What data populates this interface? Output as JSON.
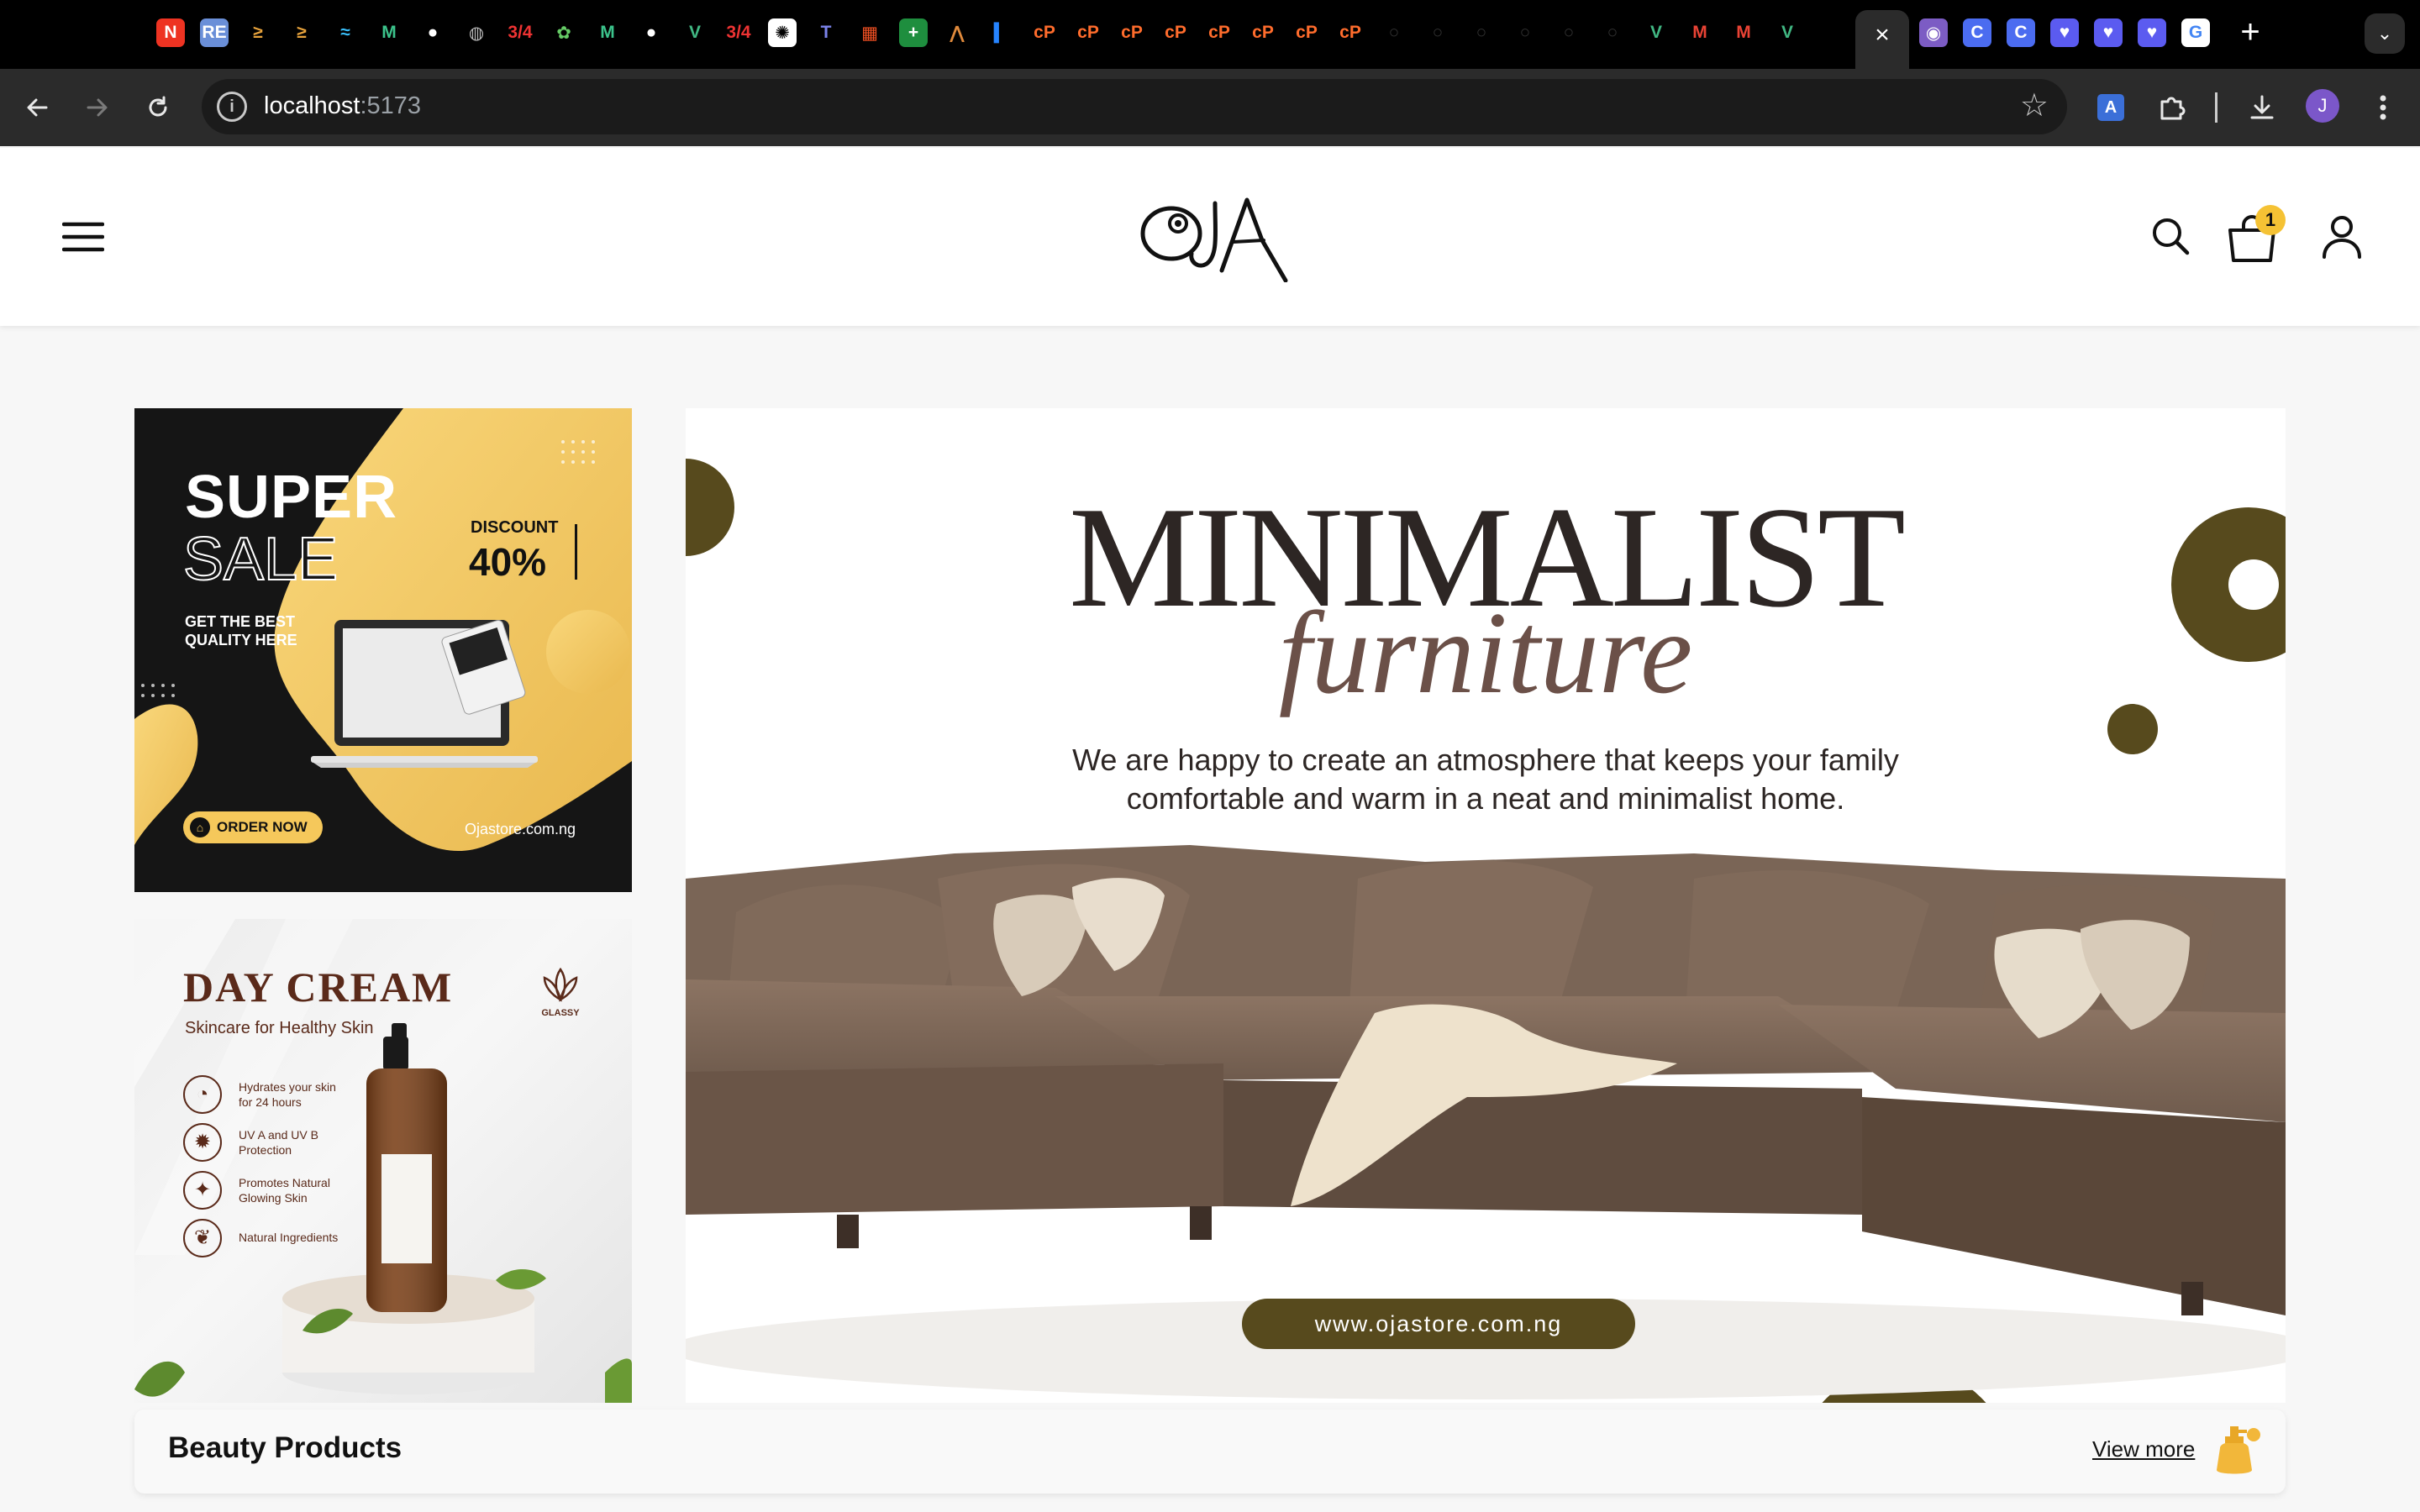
{
  "browser": {
    "url_host": "localhost",
    "url_port": ":5173",
    "profile_initial": "J",
    "tab_favicons": [
      {
        "name": "notion-icon",
        "glyph": "N",
        "bg": "#e32",
        "fg": "#fff"
      },
      {
        "name": "repo-icon",
        "glyph": "RE",
        "bg": "#6a8fd8",
        "fg": "#fff"
      },
      {
        "name": "svelte-icon",
        "glyph": "≥",
        "bg": "#000",
        "fg": "#e8a33c"
      },
      {
        "name": "svelte-icon",
        "glyph": "≥",
        "bg": "#000",
        "fg": "#e8a33c"
      },
      {
        "name": "tailwind-icon",
        "glyph": "≈",
        "bg": "#000",
        "fg": "#38bdf8"
      },
      {
        "name": "mailchimp-icon",
        "glyph": "M",
        "bg": "#000",
        "fg": "#3cc48c"
      },
      {
        "name": "github-icon",
        "glyph": "●",
        "bg": "#000",
        "fg": "#fff"
      },
      {
        "name": "globe-icon",
        "glyph": "◍",
        "bg": "#000",
        "fg": "#bbb"
      },
      {
        "name": "app-icon",
        "glyph": "3/4",
        "bg": "#000",
        "fg": "#e33"
      },
      {
        "name": "bug-icon",
        "glyph": "✿",
        "bg": "#000",
        "fg": "#6c6"
      },
      {
        "name": "mailchimp-icon",
        "glyph": "M",
        "bg": "#000",
        "fg": "#3cc48c"
      },
      {
        "name": "github-icon",
        "glyph": "●",
        "bg": "#000",
        "fg": "#fff"
      },
      {
        "name": "vue-icon",
        "glyph": "V",
        "bg": "#000",
        "fg": "#41b883"
      },
      {
        "name": "app-icon",
        "glyph": "3/4",
        "bg": "#000",
        "fg": "#e33"
      },
      {
        "name": "openai-icon",
        "glyph": "✺",
        "bg": "#fff",
        "fg": "#000"
      },
      {
        "name": "teams-icon",
        "glyph": "T",
        "bg": "#000",
        "fg": "#7b83eb"
      },
      {
        "name": "microsoft-icon",
        "glyph": "▦",
        "bg": "#000",
        "fg": "#f25022"
      },
      {
        "name": "plus-app-icon",
        "glyph": "+",
        "bg": "#1e8e3e",
        "fg": "#fff"
      },
      {
        "name": "triangle-icon",
        "glyph": "⋀",
        "bg": "#000",
        "fg": "#e08a3c"
      },
      {
        "name": "jira-icon",
        "glyph": "▍",
        "bg": "#000",
        "fg": "#2684ff"
      },
      {
        "name": "cpanel-icon",
        "glyph": "cP",
        "bg": "#000",
        "fg": "#ff6c2c"
      },
      {
        "name": "cpanel-icon",
        "glyph": "cP",
        "bg": "#000",
        "fg": "#ff6c2c"
      },
      {
        "name": "cpanel-icon",
        "glyph": "cP",
        "bg": "#000",
        "fg": "#ff6c2c"
      },
      {
        "name": "cpanel-icon",
        "glyph": "cP",
        "bg": "#000",
        "fg": "#ff6c2c"
      },
      {
        "name": "cpanel-icon",
        "glyph": "cP",
        "bg": "#000",
        "fg": "#ff6c2c"
      },
      {
        "name": "cpanel-icon",
        "glyph": "cP",
        "bg": "#000",
        "fg": "#ff6c2c"
      },
      {
        "name": "cpanel-icon",
        "glyph": "cP",
        "bg": "#000",
        "fg": "#ff6c2c"
      },
      {
        "name": "cpanel-icon",
        "glyph": "cP",
        "bg": "#000",
        "fg": "#ff6c2c"
      },
      {
        "name": "loading-icon",
        "glyph": "○",
        "bg": "#000",
        "fg": "#333"
      },
      {
        "name": "loading-icon",
        "glyph": "○",
        "bg": "#000",
        "fg": "#333"
      },
      {
        "name": "loading-icon",
        "glyph": "○",
        "bg": "#000",
        "fg": "#333"
      },
      {
        "name": "loading-icon",
        "glyph": "○",
        "bg": "#000",
        "fg": "#333"
      },
      {
        "name": "loading-icon",
        "glyph": "○",
        "bg": "#000",
        "fg": "#333"
      },
      {
        "name": "loading-icon",
        "glyph": "○",
        "bg": "#000",
        "fg": "#333"
      },
      {
        "name": "vue-icon",
        "glyph": "V",
        "bg": "#000",
        "fg": "#41b883"
      },
      {
        "name": "gmail-icon",
        "glyph": "M",
        "bg": "#000",
        "fg": "#ea4335"
      },
      {
        "name": "gmail-icon",
        "glyph": "M",
        "bg": "#000",
        "fg": "#ea4335"
      },
      {
        "name": "vue-icon",
        "glyph": "V",
        "bg": "#000",
        "fg": "#41b883"
      }
    ],
    "tab_favicons_right": [
      {
        "name": "obsidian-icon",
        "glyph": "◉",
        "bg": "#7c5cc4",
        "fg": "#fff"
      },
      {
        "name": "canva-icon",
        "glyph": "C",
        "bg": "#4b6cf0",
        "fg": "#fff"
      },
      {
        "name": "canva-icon",
        "glyph": "C",
        "bg": "#4b6cf0",
        "fg": "#fff"
      },
      {
        "name": "heart-app-icon",
        "glyph": "♥",
        "bg": "#5b5bf0",
        "fg": "#fff"
      },
      {
        "name": "heart-app-icon",
        "glyph": "♥",
        "bg": "#5b5bf0",
        "fg": "#fff"
      },
      {
        "name": "heart-app-icon",
        "glyph": "♥",
        "bg": "#5b5bf0",
        "fg": "#fff"
      },
      {
        "name": "google-icon",
        "glyph": "G",
        "bg": "#fff",
        "fg": "#4285f4"
      }
    ]
  },
  "header": {
    "cart_count": "1",
    "logo_text": "OJA"
  },
  "ads": {
    "sale": {
      "line1": "SUPER",
      "line2": "SALE",
      "discount_label": "DISCOUNT",
      "discount_value": "40%",
      "tagline_1": "GET THE BEST",
      "tagline_2": "QUALITY HERE",
      "cta": "ORDER NOW",
      "site": "Ojastore.com.ng"
    },
    "cream": {
      "title": "DAY CREAM",
      "subtitle": "Skincare for Healthy Skin",
      "brand": "GLASSY",
      "features": [
        {
          "line1": "Hydrates your skin",
          "line2": "for 24 hours",
          "icon": "drop-icon"
        },
        {
          "line1": "UV A and UV B",
          "line2": "Protection",
          "icon": "sun-icon"
        },
        {
          "line1": "Promotes Natural",
          "line2": "Glowing Skin",
          "icon": "sparkle-icon"
        },
        {
          "line1": "Natural Ingredients",
          "line2": "",
          "icon": "leaf-icon"
        }
      ]
    }
  },
  "hero": {
    "title": "MINIMALIST",
    "script": "furniture",
    "desc_1": "We are happy to create an atmosphere that keeps your family",
    "desc_2": "comfortable and warm in a neat and minimalist home.",
    "url_button": "www.ojastore.com.ng",
    "accent": "#574a1d"
  },
  "section": {
    "title": "Beauty Products",
    "view_more": "View more"
  }
}
